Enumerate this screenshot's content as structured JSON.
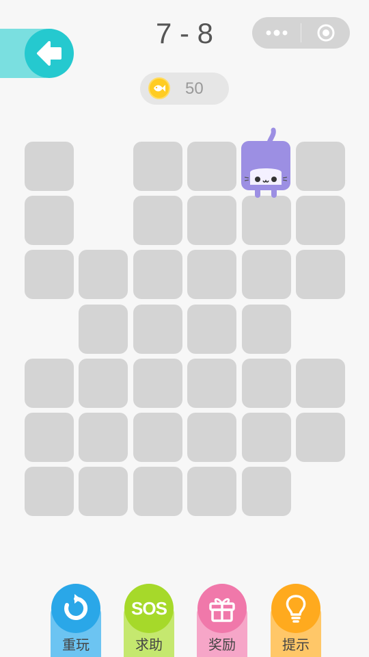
{
  "header": {
    "level": "7 - 8",
    "back_icon": "arrow-left-icon",
    "menu_icon": "more-dots-icon",
    "close_icon": "target-circle-icon"
  },
  "coins": {
    "icon": "fish-coin-icon",
    "count": "50"
  },
  "board": {
    "rows": [
      [
        1,
        0,
        1,
        1,
        1,
        1
      ],
      [
        1,
        0,
        1,
        1,
        1,
        1
      ],
      [
        1,
        1,
        1,
        1,
        1,
        1
      ],
      [
        0,
        1,
        1,
        1,
        1,
        0
      ],
      [
        1,
        1,
        1,
        1,
        1,
        1
      ],
      [
        1,
        1,
        1,
        1,
        1,
        1
      ],
      [
        1,
        1,
        1,
        1,
        1,
        0
      ]
    ],
    "cat": {
      "row": 0,
      "col": 4
    },
    "colors": {
      "tile": "#d4d4d4",
      "cat": "#9c8fe3"
    }
  },
  "tools": [
    {
      "id": "restart",
      "label": "重玩",
      "icon": "restart-icon",
      "color": "#2aa7e8",
      "stem": "#6cc4f2"
    },
    {
      "id": "sos",
      "label": "求助",
      "icon": "sos-icon",
      "text": "SOS",
      "color": "#a6d92a",
      "stem": "#c5e86f"
    },
    {
      "id": "reward",
      "label": "奖励",
      "icon": "gift-icon",
      "color": "#f078aa",
      "stem": "#f6a6c8"
    },
    {
      "id": "hint",
      "label": "提示",
      "icon": "lightbulb-icon",
      "color": "#ffaa1e",
      "stem": "#ffc768"
    }
  ]
}
